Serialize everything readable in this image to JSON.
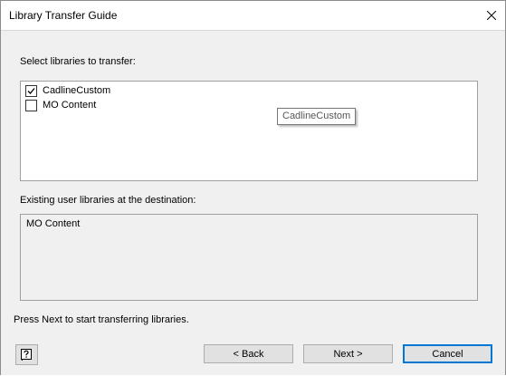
{
  "window": {
    "title": "Library Transfer Guide"
  },
  "select_section": {
    "label": "Select libraries to transfer:",
    "items": [
      {
        "label": "CadlineCustom",
        "checked": true
      },
      {
        "label": "MO Content",
        "checked": false
      }
    ],
    "tooltip": "CadlineCustom"
  },
  "existing_section": {
    "label": "Existing user libraries at the destination:",
    "items": [
      "MO Content"
    ]
  },
  "instruction": "Press Next to start transferring libraries.",
  "buttons": {
    "back": "< Back",
    "next": "Next >",
    "cancel": "Cancel"
  },
  "icons": {
    "close": "close-icon",
    "help": "help-icon",
    "check": "checkmark-icon"
  },
  "colors": {
    "default_button_border": "#0078d7",
    "dialog_background": "#f0f0f0"
  }
}
